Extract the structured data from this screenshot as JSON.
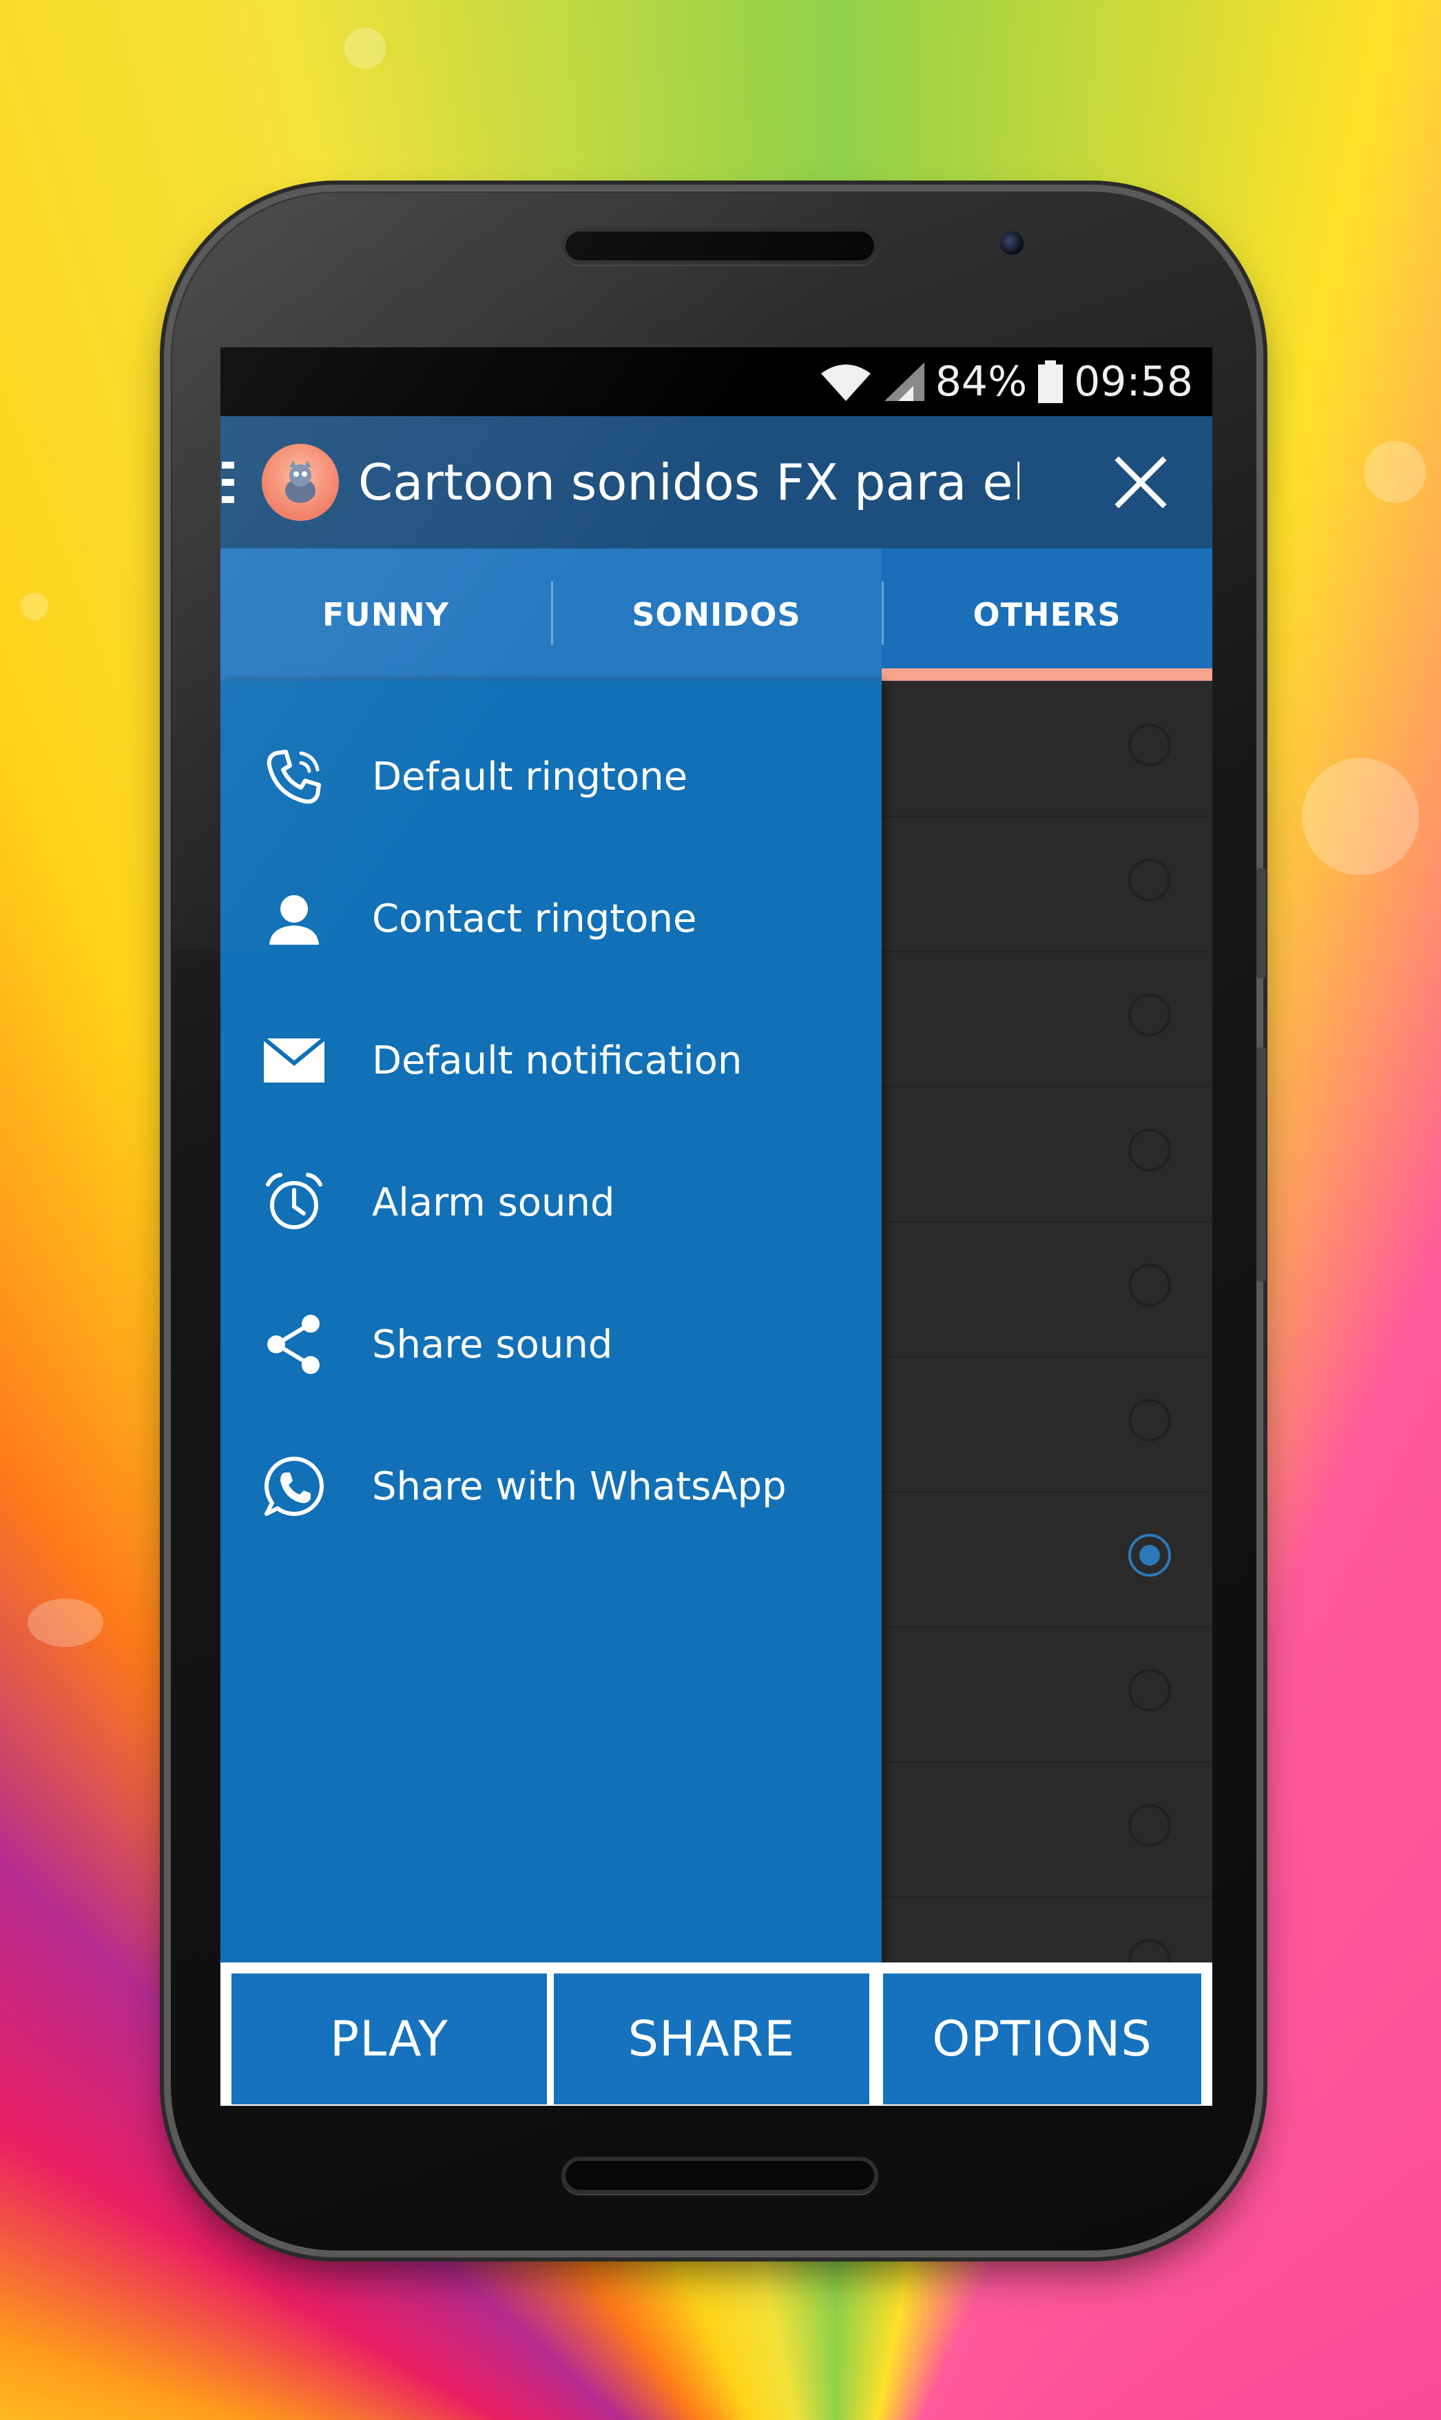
{
  "status_bar": {
    "battery": "84%",
    "time": "09:58",
    "icons": [
      "wifi-icon",
      "signal-icon",
      "battery-icon"
    ]
  },
  "action_bar": {
    "title": "Cartoon sonidos FX para el…",
    "icons": [
      "menu-icon",
      "app-logo-icon",
      "close-icon"
    ]
  },
  "tabs": [
    {
      "label": "FUNNY",
      "active": false
    },
    {
      "label": "SONIDOS",
      "active": false
    },
    {
      "label": "OTHERS",
      "active": true
    }
  ],
  "drawer": {
    "items": [
      {
        "label": "Default ringtone",
        "icon": "phone-ringing-icon"
      },
      {
        "label": "Contact ringtone",
        "icon": "contact-icon"
      },
      {
        "label": "Default notification",
        "icon": "envelope-icon"
      },
      {
        "label": "Alarm sound",
        "icon": "alarm-clock-icon"
      },
      {
        "label": "Share sound",
        "icon": "share-icon"
      },
      {
        "label": "Share with WhatsApp",
        "icon": "whatsapp-icon"
      }
    ]
  },
  "sound_list": {
    "selected_index": 6
  },
  "bottom_bar": {
    "play": "PLAY",
    "share": "SHARE",
    "options": "OPTIONS"
  },
  "colors": {
    "action_bar": "#1d4f7e",
    "tab_bar": "#2679c0",
    "tab_indicator": "#f6a48e",
    "drawer": "#1170b6",
    "list_background": "#2a2a2a",
    "bottom_button": "#1672bc"
  }
}
